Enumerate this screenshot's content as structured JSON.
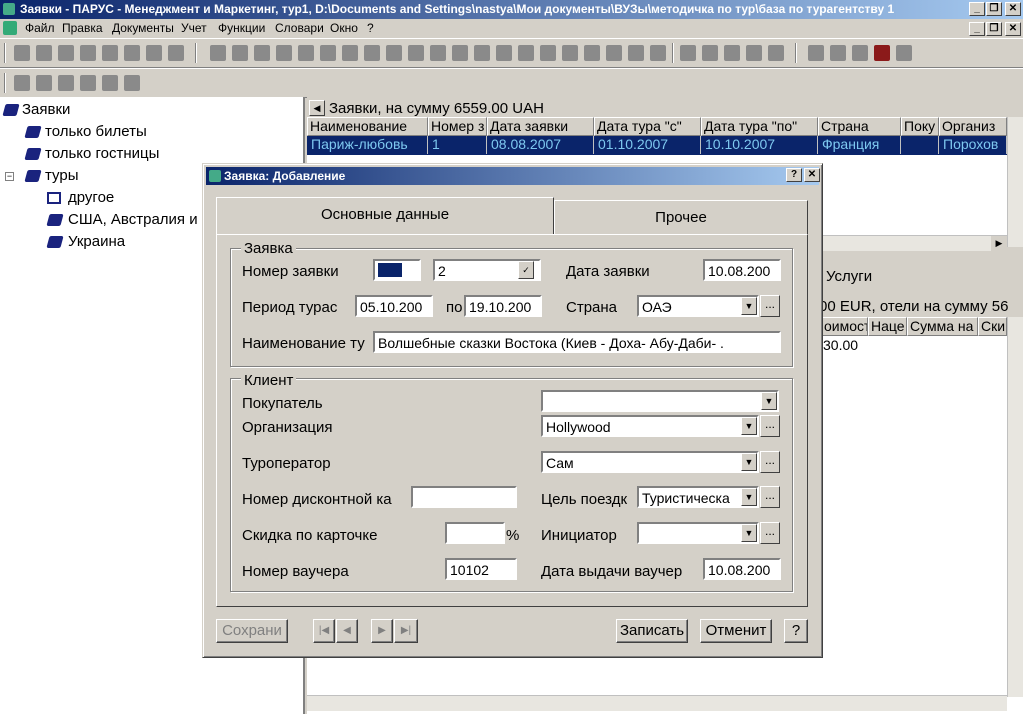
{
  "window": {
    "title": "Заявки - ПАРУС - Менеджмент и Маркетинг, тур1, D:\\Documents and Settings\\nastya\\Мои документы\\ВУЗы\\методичка по тур\\база по турагентству 1"
  },
  "menu": {
    "items": [
      "Файл",
      "Правка",
      "Документы",
      "Учет",
      "Функции",
      "Словари",
      "Окно",
      "?"
    ]
  },
  "tree": {
    "root": "Заявки",
    "items": [
      "только билеты",
      "только гостницы",
      "туры",
      "другое",
      "США, Австралия и",
      "Украина"
    ]
  },
  "grid": {
    "header_label": "Заявки, на сумму 6559.00 UAH",
    "columns": [
      "Наименование",
      "Номер з",
      "Дата заявки",
      "Дата тура \"с\"",
      "Дата тура \"по\"",
      "Страна",
      "Поку",
      "Организ"
    ],
    "row": [
      "Париж-любовь",
      "1",
      "08.08.2007",
      "01.10.2007",
      "10.10.2007",
      "Франция",
      "",
      "Порохов"
    ],
    "services_tab": "Услуги",
    "services_summary": "00 EUR, отели на сумму 56",
    "services_columns": [
      "оимост",
      "Наце",
      "Сумма на",
      "Ски"
    ],
    "services_value": "30.00"
  },
  "dialog": {
    "title": "Заявка: Добавление",
    "tabs": [
      "Основные данные",
      "Прочее"
    ],
    "request_group": "Заявка",
    "client_group": "Клиент",
    "labels": {
      "number": "Номер заявки",
      "date": "Дата заявки",
      "period": "Период турас",
      "to": "по",
      "country": "Страна",
      "tour_name": "Наименование ту",
      "buyer": "Покупатель",
      "org": "Организация",
      "operator": "Туроператор",
      "card_number": "Номер дисконтной ка",
      "purpose": "Цель поездк",
      "discount": "Скидка по карточке",
      "percent": "%",
      "initiator": "Инициатор",
      "voucher": "Номер ваучера",
      "voucher_date": "Дата выдачи ваучер"
    },
    "values": {
      "number": "2",
      "date": "10.08.200",
      "period_from": "05.10.200",
      "period_to": "19.10.200",
      "country": "ОАЭ",
      "tour_name": "Волшебные сказки Востока (Киев - Доха- Абу-Даби- .",
      "buyer": "",
      "org": "Hollywood",
      "operator": "Сам",
      "card_number": "",
      "purpose": "Туристическа",
      "discount": "",
      "initiator": "",
      "voucher": "10102",
      "voucher_date": "10.08.200"
    },
    "buttons": {
      "save": "Сохрани",
      "write": "Записать",
      "cancel": "Отменит",
      "help": "?"
    }
  }
}
